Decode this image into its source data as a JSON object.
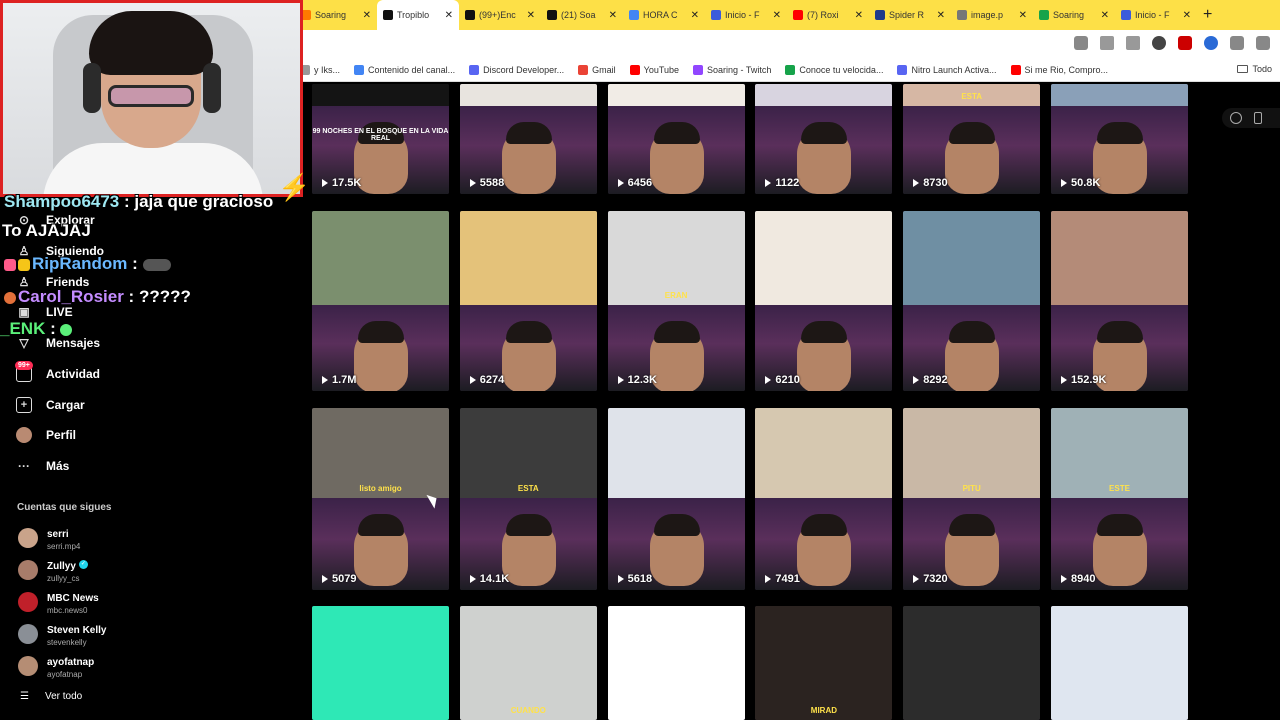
{
  "browser": {
    "tabs": [
      {
        "title": "Soaring",
        "color": "#ff7a00"
      },
      {
        "title": "Tropiblo",
        "color": "#111111",
        "active": true
      },
      {
        "title": "(99+)Enc",
        "color": "#111111"
      },
      {
        "title": "(21) Soa",
        "color": "#111111"
      },
      {
        "title": "HORA C",
        "color": "#4285f4"
      },
      {
        "title": "Inicio - F",
        "color": "#3b5bdb"
      },
      {
        "title": "(7) Roxi",
        "color": "#ff0000"
      },
      {
        "title": "Spider R",
        "color": "#1e3a8a"
      },
      {
        "title": "image.p",
        "color": "#777777"
      },
      {
        "title": "Soaring",
        "color": "#16a34a"
      },
      {
        "title": "Inicio - F",
        "color": "#3b5bdb"
      }
    ],
    "new_tab": "+",
    "bookmarks": [
      {
        "label": "y Iks...",
        "color": "#999999"
      },
      {
        "label": "Contenido del canal...",
        "color": "#4285f4"
      },
      {
        "label": "Discord Developer...",
        "color": "#5865f2"
      },
      {
        "label": "Gmail",
        "color": "#ea4335"
      },
      {
        "label": "YouTube",
        "color": "#ff0000"
      },
      {
        "label": "Soaring - Twitch",
        "color": "#9146ff"
      },
      {
        "label": "Conoce tu velocida...",
        "color": "#16a34a"
      },
      {
        "label": "Nitro Launch Activa...",
        "color": "#5865f2"
      },
      {
        "label": "Si me Rio, Compro...",
        "color": "#ff0000"
      }
    ],
    "bookmarks_right": "Todo"
  },
  "chat": [
    {
      "user": "Shampoo6473",
      "sep": " : ",
      "msg": "jaja que gracioso"
    },
    {
      "user": "",
      "sep": "",
      "msg": "To AJAJAJ"
    },
    {
      "user": "RipRandom",
      "sep": " : ",
      "msg": ""
    },
    {
      "user": "Carol_Rosier",
      "sep": " : ",
      "msg": "?????"
    },
    {
      "user": "_ENK",
      "sep": " : ",
      "msg": ""
    }
  ],
  "sidebar": {
    "nav": [
      {
        "label": "Explorar",
        "icon": "compass-icon"
      },
      {
        "label": "Siguiendo",
        "icon": "following-icon"
      },
      {
        "label": "Friends",
        "icon": "friends-icon"
      },
      {
        "label": "LIVE",
        "icon": "live-icon"
      },
      {
        "label": "Mensajes",
        "icon": "messages-icon"
      },
      {
        "label": "Actividad",
        "icon": "activity-icon",
        "badge": "99+"
      },
      {
        "label": "Cargar",
        "icon": "upload-icon"
      },
      {
        "label": "Perfil",
        "icon": "profile-icon"
      },
      {
        "label": "Más",
        "icon": "more-icon"
      }
    ],
    "following_title": "Cuentas que sigues",
    "following": [
      {
        "name": "serri",
        "handle": "serri.mp4",
        "color": "#c9a38a"
      },
      {
        "name": "Zullyy",
        "handle": "zullyy_cs",
        "color": "#a87c6a",
        "verified": true
      },
      {
        "name": "MBC News",
        "handle": "mbc.news0",
        "color": "#c0202a"
      },
      {
        "name": "Steven Kelly",
        "handle": "stevenkelly",
        "color": "#8a8f96"
      },
      {
        "name": "ayofatnap",
        "handle": "ayofatnap",
        "color": "#b58d74"
      }
    ],
    "see_all": "Ver todo"
  },
  "grid": {
    "rows": [
      [
        {
          "views": "17.5K",
          "caption": "99 NOCHES EN EL BOSQUE EN LA VIDA REAL",
          "top_color": "#141414"
        },
        {
          "views": "5588",
          "caption": "",
          "top_color": "#e8e4df"
        },
        {
          "views": "6456",
          "caption": "",
          "top_color": "#f1ece6"
        },
        {
          "views": "1122",
          "caption": "",
          "top_color": "#d8d4e0"
        },
        {
          "views": "8730",
          "caption": "ESTA",
          "top_color": "#d6b7a4"
        },
        {
          "views": "50.8K",
          "caption": "",
          "top_color": "#8aa0b8"
        }
      ],
      [
        {
          "views": "1.7M",
          "caption": "",
          "top_color": "#7b8f6e"
        },
        {
          "views": "6274",
          "caption": "",
          "top_color": "#e4c27a"
        },
        {
          "views": "12.3K",
          "caption": "ERAN",
          "top_color": "#d9d9d9"
        },
        {
          "views": "6210",
          "caption": "",
          "top_color": "#f0e9e0"
        },
        {
          "views": "8292",
          "caption": "",
          "top_color": "#6f8fa3"
        },
        {
          "views": "152.9K",
          "caption": "",
          "top_color": "#b48b78"
        }
      ],
      [
        {
          "views": "5079",
          "caption": "listo amigo",
          "top_color": "#6f6a62"
        },
        {
          "views": "14.1K",
          "caption": "ESTA",
          "top_color": "#3c3c3c"
        },
        {
          "views": "5618",
          "caption": "",
          "top_color": "#dfe3ea"
        },
        {
          "views": "7491",
          "caption": "",
          "top_color": "#d6c8b0"
        },
        {
          "views": "7320",
          "caption": "PITU",
          "top_color": "#c9b8a6"
        },
        {
          "views": "8940",
          "caption": "ESTE",
          "top_color": "#9fb1b6"
        }
      ],
      [
        {
          "views": "",
          "caption": "",
          "top_color": "#2ee8b6"
        },
        {
          "views": "",
          "caption": "CUANDO",
          "top_color": "#cfd1cf"
        },
        {
          "views": "",
          "caption": "",
          "top_color": "#ffffff"
        },
        {
          "views": "",
          "caption": "MIRAD",
          "top_color": "#2b2320"
        },
        {
          "views": "",
          "caption": "",
          "top_color": "#2c2c2c"
        },
        {
          "views": "",
          "caption": "",
          "top_color": "#dfe6f0"
        }
      ]
    ]
  }
}
